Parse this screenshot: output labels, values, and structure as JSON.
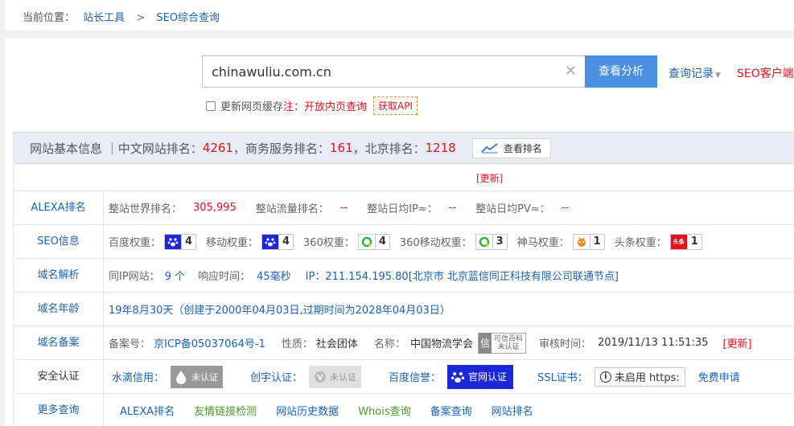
{
  "breadcrumb": {
    "prefix": "当前位置：",
    "tools": "站长工具",
    "sep": ">",
    "current": "SEO综合查询"
  },
  "search": {
    "value": "chinawuliu.com.cn",
    "button": "查看分析",
    "history": "查询记录",
    "client": "SEO客户端下载"
  },
  "options": {
    "refresh_cache": "更新网页缓存",
    "note": "注：开放内页查询",
    "api": "获取API"
  },
  "info_header": {
    "title": "网站基本信息 ｜中文网站排名：",
    "cn_rank": "4261",
    "biz_label": "，商务服务排名：",
    "biz_rank": "161",
    "bj_label": "，北京排名：",
    "bj_rank": "1218",
    "rank_btn": "查看排名"
  },
  "update_label": "[更新]",
  "rows": {
    "alexa": {
      "label": "ALEXA排名",
      "world_label": "整站世界排名：",
      "world_val": "305,995",
      "traffic_label": "整站流量排名：",
      "traffic_val": "--",
      "ip_label": "整站日均IP≈：",
      "ip_val": "--",
      "pv_label": "整站日均PV≈：",
      "pv_val": "--"
    },
    "seo": {
      "label": "SEO信息",
      "baidu_label": "百度权重：",
      "baidu_val": "4",
      "mobile_label": "移动权重：",
      "mobile_val": "4",
      "s360_label": "360权重：",
      "s360_val": "4",
      "s360m_label": "360移动权重：",
      "s360m_val": "3",
      "sm_label": "神马权重：",
      "sm_val": "1",
      "tt_label": "头条权重：",
      "tt_val": "1",
      "tt_icon_text": "头条"
    },
    "dns": {
      "label": "域名解析",
      "sameip_label": "同IP网站：",
      "sameip_val": "9 个",
      "resp_label": "响应时间：",
      "resp_val": "45毫秒",
      "ip_text": "IP：211.154.195.80[北京市 北京蓝信同正科技有限公司联通节点]"
    },
    "age": {
      "label": "域名年龄",
      "text": "19年8月30天（创建于2000年04月03日,过期时间为2028年04月03日）"
    },
    "icp": {
      "label": "域名备案",
      "no_label": "备案号：",
      "no_val": "京ICP备05037064号-1",
      "type_label": "性质：",
      "type_val": "社会团体",
      "name_label": "名称：",
      "name_val": "中国物流学会",
      "trust_line1": "可信百科",
      "trust_line2": "未认证",
      "audit_label": "审核时间：",
      "audit_val": "2019/11/13 11:51:35",
      "update": "[更新]"
    },
    "security": {
      "label": "安全认证",
      "water_label": "水滴信用：",
      "water_badge": "未认证",
      "chuangzi_label": "创宇认证：",
      "chuangzi_badge": "未认证",
      "baidu_label": "百度信誉：",
      "baidu_badge": "官网认证",
      "ssl_label": "SSL证书：",
      "ssl_btn": "未启用 https:",
      "free": "免费申请"
    },
    "more": {
      "label": "更多查询",
      "links": [
        "ALEXA排名",
        "友情链接检测",
        "网站历史数据",
        "Whois查询",
        "备案查询",
        "网站排名"
      ]
    }
  },
  "colors": {
    "link_blue": "#1a62b8",
    "alert_red": "#e8101d",
    "button_blue": "#4a90e2",
    "baidu_badge_blue": "#1b27d8",
    "green_link": "#4a9a2a"
  }
}
